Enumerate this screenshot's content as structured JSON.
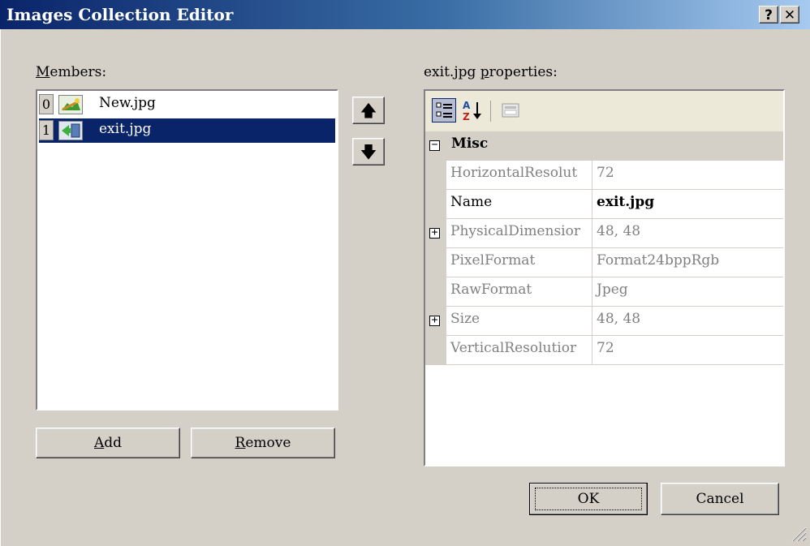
{
  "window": {
    "title": "Images Collection Editor",
    "help_label": "?",
    "close_label": "✕"
  },
  "members": {
    "label": "Members:",
    "items": [
      {
        "index": "0",
        "name": "New.jpg",
        "icon": "new-image-icon"
      },
      {
        "index": "1",
        "name": "exit.jpg",
        "icon": "exit-image-icon",
        "selected": true
      }
    ],
    "move_up_label": "🡅",
    "move_down_label": "🡇",
    "add_label": "Add",
    "remove_label": "Remove"
  },
  "properties": {
    "label": "exit.jpg properties:",
    "category": {
      "name": "Misc",
      "expander": "−"
    },
    "rows": [
      {
        "name": "HorizontalResolut",
        "value": "72"
      },
      {
        "name": "Name",
        "value": "exit.jpg",
        "bold": true
      },
      {
        "name": "PhysicalDimensior",
        "value": "48, 48",
        "expander": "+"
      },
      {
        "name": "PixelFormat",
        "value": "Format24bppRgb"
      },
      {
        "name": "RawFormat",
        "value": "Jpeg"
      },
      {
        "name": "Size",
        "value": "48, 48",
        "expander": "+"
      },
      {
        "name": "VerticalResolutior",
        "value": "72"
      }
    ]
  },
  "footer": {
    "ok_label": "OK",
    "cancel_label": "Cancel"
  },
  "colors": {
    "selection": "#0a246a",
    "face": "#d4d0c8",
    "title_start": "#0a246a",
    "title_end": "#a6caf0"
  }
}
